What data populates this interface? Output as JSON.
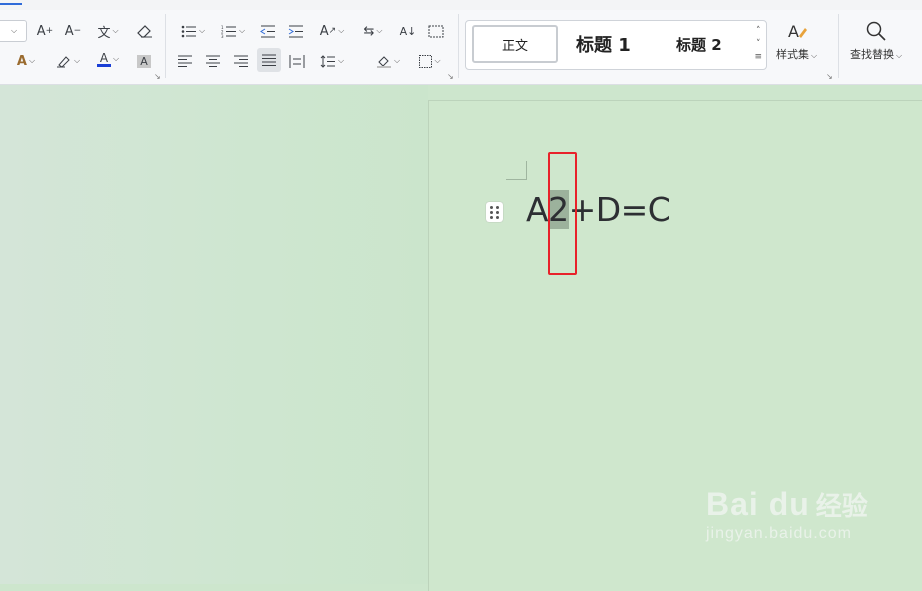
{
  "styles_gallery": {
    "normal": "正文",
    "heading1": "标题 1",
    "heading2": "标题 2"
  },
  "ribbon": {
    "styles_set_label": "样式集",
    "find_replace_label": "查找替换"
  },
  "document": {
    "text_before": "A",
    "selected_text": "2",
    "text_after": "+D=C"
  },
  "watermark": {
    "brand": "Bai du",
    "brand_cn": "经验",
    "url": "jingyan.baidu.com"
  },
  "colors": {
    "font_color_bar": "#1a3fd6",
    "highlight": "#9cb29c",
    "annotation_box": "#e8222a",
    "page_background": "#cfe7cd"
  },
  "icons": [
    "format-painter-icon",
    "increase-font-icon",
    "decrease-font-icon",
    "phonetic-guide-icon",
    "clear-format-icon",
    "text-effect-icon",
    "highlight-icon",
    "font-color-icon",
    "char-shading-icon",
    "bullets-icon",
    "numbering-icon",
    "decrease-indent-icon",
    "increase-indent-icon",
    "text-direction-icon",
    "sort-icon",
    "show-marks-icon",
    "align-left-icon",
    "align-center-icon",
    "align-right-icon",
    "justify-icon",
    "distributed-icon",
    "line-spacing-icon",
    "shading-icon",
    "borders-icon",
    "styles-set-icon",
    "search-icon"
  ]
}
